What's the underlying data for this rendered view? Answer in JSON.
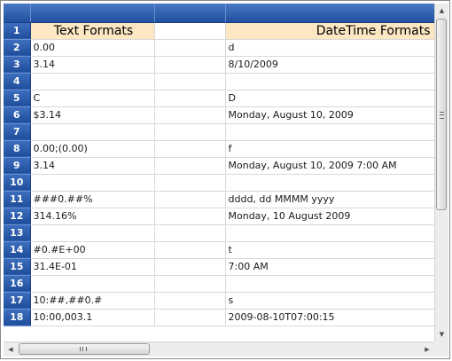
{
  "window": {
    "title": ""
  },
  "column_headers": [
    "",
    "",
    "",
    ""
  ],
  "rows": [
    {
      "num": "1",
      "a": "Text Formats",
      "b": "",
      "c": "DateTime Formats"
    },
    {
      "num": "2",
      "a": "0.00",
      "b": "",
      "c": "d"
    },
    {
      "num": "3",
      "a": "3.14",
      "b": "",
      "c": "8/10/2009"
    },
    {
      "num": "4",
      "a": "",
      "b": "",
      "c": ""
    },
    {
      "num": "5",
      "a": "C",
      "b": "",
      "c": "D"
    },
    {
      "num": "6",
      "a": "$3.14",
      "b": "",
      "c": "Monday, August 10, 2009"
    },
    {
      "num": "7",
      "a": "",
      "b": "",
      "c": ""
    },
    {
      "num": "8",
      "a": "0.00;(0.00)",
      "b": "",
      "c": "f"
    },
    {
      "num": "9",
      "a": "3.14",
      "b": "",
      "c": "Monday, August 10, 2009 7:00 AM"
    },
    {
      "num": "10",
      "a": "",
      "b": "",
      "c": ""
    },
    {
      "num": "11",
      "a": "###0.##%",
      "b": "",
      "c": "dddd, dd MMMM yyyy"
    },
    {
      "num": "12",
      "a": "314.16%",
      "b": "",
      "c": "Monday, 10 August 2009"
    },
    {
      "num": "13",
      "a": "",
      "b": "",
      "c": ""
    },
    {
      "num": "14",
      "a": "#0.#E+00",
      "b": "",
      "c": "t"
    },
    {
      "num": "15",
      "a": "31.4E-01",
      "b": "",
      "c": "7:00 AM"
    },
    {
      "num": "16",
      "a": "",
      "b": "",
      "c": ""
    },
    {
      "num": "17",
      "a": "10:##,##0.#",
      "b": "",
      "c": "s"
    },
    {
      "num": "18",
      "a": "10:00,003.1",
      "b": "",
      "c": "2009-08-10T07:00:15"
    }
  ],
  "scrollbars": {
    "up_arrow": "▲",
    "down_arrow": "▼",
    "left_arrow": "◀",
    "right_arrow": "▶"
  },
  "colors": {
    "header_blue": "#2a5aab",
    "header_cell_fill": "#fde6c2",
    "gridline": "#d9d9d9"
  }
}
